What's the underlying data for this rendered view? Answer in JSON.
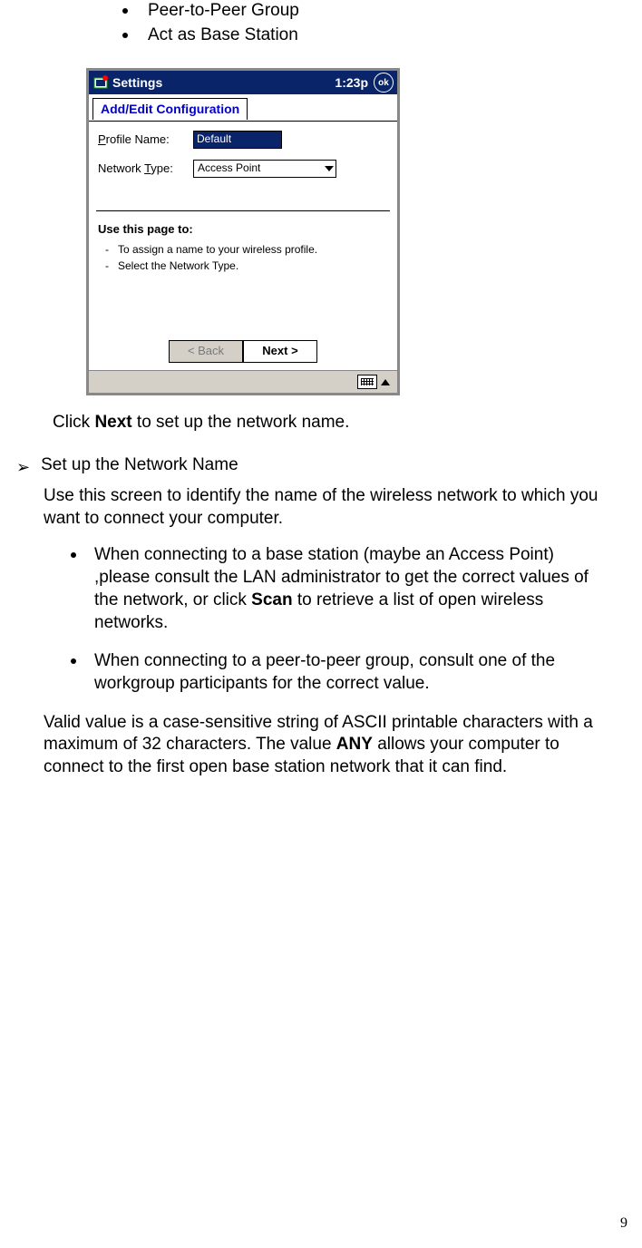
{
  "top_bullets": {
    "item1": "Peer-to-Peer Group",
    "item2": "Act as Base Station"
  },
  "screenshot": {
    "title": "Settings",
    "time": "1:23p",
    "ok": "ok",
    "tab": "Add/Edit Configuration",
    "profile_label_prefix": "P",
    "profile_label_rest": "rofile Name:",
    "profile_value": "Default",
    "network_label_prefix": "Network ",
    "network_label_ul": "T",
    "network_label_rest": "ype:",
    "network_value": "Access Point",
    "help_title": "Use this page to:",
    "help1": "To assign a name to your wireless profile.",
    "help2": "Select the Network Type.",
    "back": "< Back",
    "next": "Next >"
  },
  "instruction_pre": "Click ",
  "instruction_bold": "Next",
  "instruction_post": " to set up the network name.",
  "section_title": "Set up the Network Name",
  "section_intro": "Use this screen to identify the name of the wireless network to which you want to connect your computer.",
  "sub1_pre": "When connecting to a base station (maybe an Access Point) ,please consult the LAN administrator to get the correct values of the network, or click ",
  "sub1_bold": "Scan",
  "sub1_post": " to retrieve a list of open wireless networks.",
  "sub2": "When connecting to a peer-to-peer group, consult one of the workgroup participants for the correct value.",
  "valid_pre": "Valid value is a case-sensitive string of ASCII printable characters with a maximum of 32 characters. The value ",
  "valid_bold": "ANY",
  "valid_post": " allows your computer to connect to the first open base station network that it can find.",
  "page_number": "9"
}
